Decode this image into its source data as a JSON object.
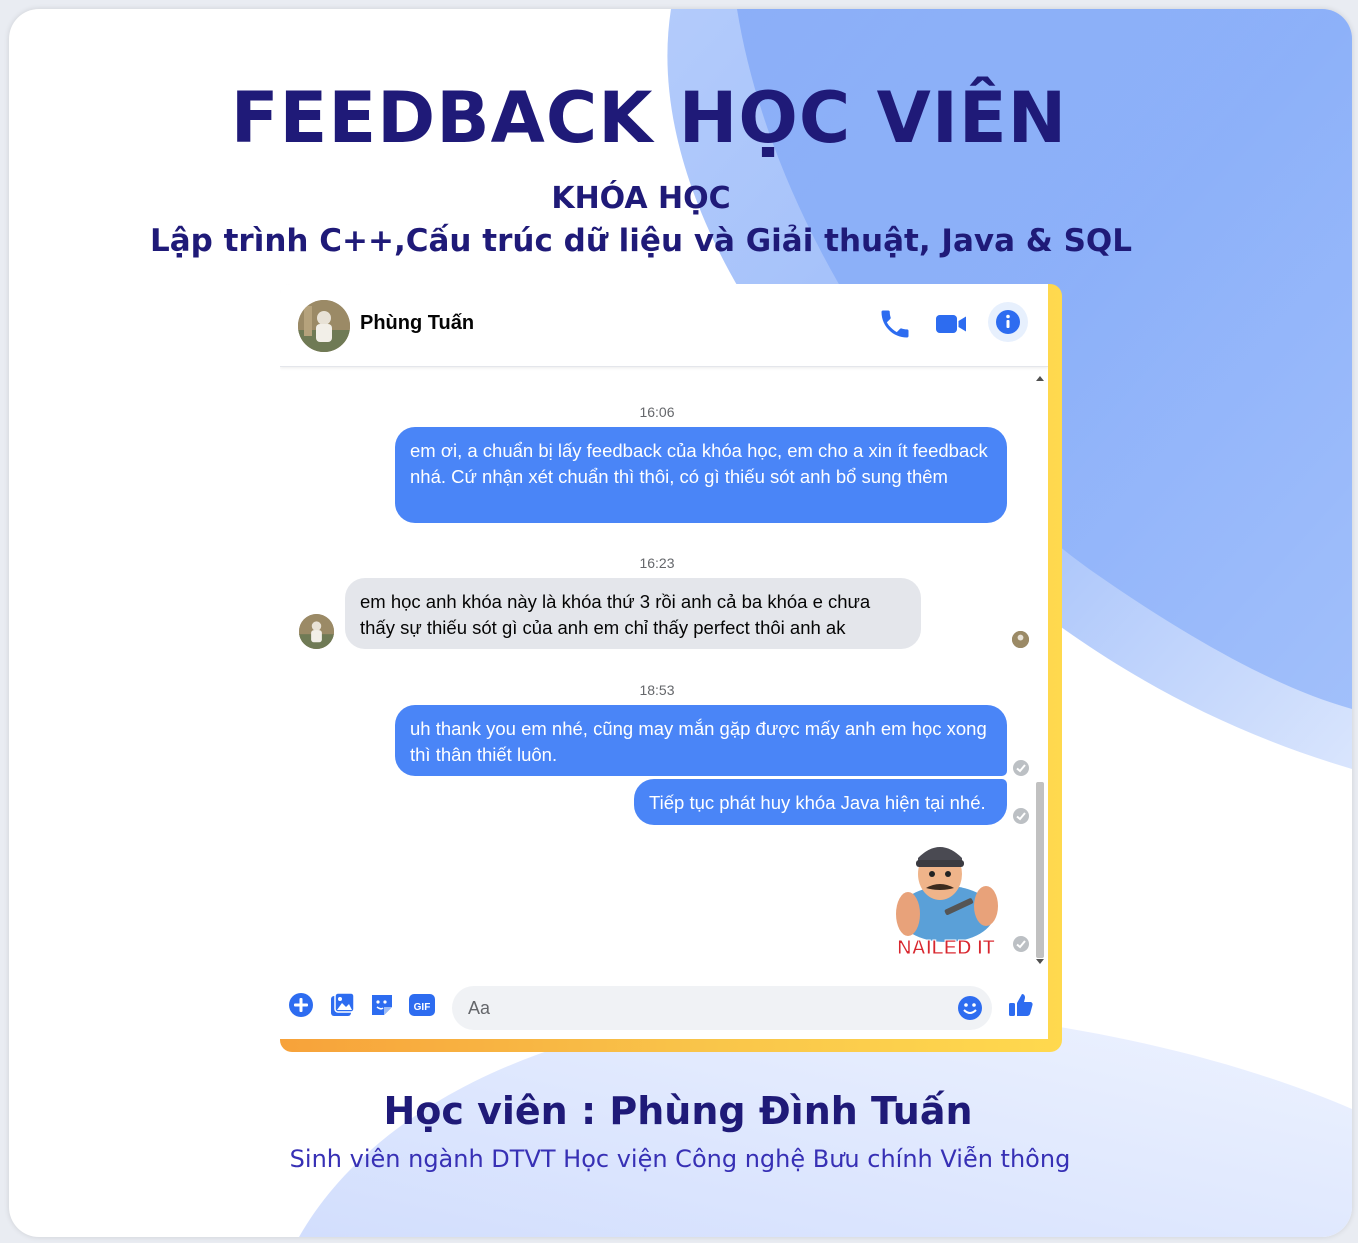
{
  "page": {
    "title": "FEEDBACK HỌC VIÊN",
    "course_label": "KHÓA HỌC",
    "course_name": "Lập trình C++,Cấu trúc dữ liệu và Giải thuật, Java & SQL",
    "student_name": "Học viên : Phùng Đình Tuấn",
    "student_desc": "Sinh viên ngành DTVT Học viện Công nghệ Bưu chính Viễn thông"
  },
  "chat": {
    "contact_name": "Phùng Tuấn",
    "header_icons": [
      "phone-icon",
      "video-camera-icon",
      "info-icon"
    ],
    "timestamps": [
      "16:06",
      "16:23",
      "18:53"
    ],
    "messages": [
      {
        "from": "me",
        "text": "em ơi, a chuẩn bị lấy feedback của khóa học, em cho a xin ít feedback nhá. Cứ nhận xét chuẩn thì thôi, có gì thiếu sót anh bổ sung thêm"
      },
      {
        "from": "contact",
        "text": "em học anh khóa này là khóa thứ 3 rồi anh cả ba khóa e chưa thấy sự thiếu sót gì của anh em chỉ thấy perfect thôi anh ak"
      },
      {
        "from": "me",
        "text": "uh thank you em nhé, cũng may mắn gặp được mấy anh em học xong thì thân thiết luôn."
      },
      {
        "from": "me",
        "text": "Tiếp tục phát huy khóa Java hiện tại nhé."
      }
    ],
    "sticker_text": "NAILED IT",
    "composer": {
      "placeholder": "Aa",
      "icons": [
        "plus-icon",
        "image-icon",
        "sticker-icon",
        "gif-icon",
        "emoji-icon",
        "thumbs-up-icon"
      ],
      "gif_label": "GIF"
    }
  },
  "colors": {
    "title": "#1f1a78",
    "messenger_blue": "#4a85f7",
    "incoming_bubble": "#e4e6eb",
    "frame_orange": "#f7a23a",
    "frame_yellow": "#ffd94e",
    "bg_blue": "#8fb2f9"
  }
}
